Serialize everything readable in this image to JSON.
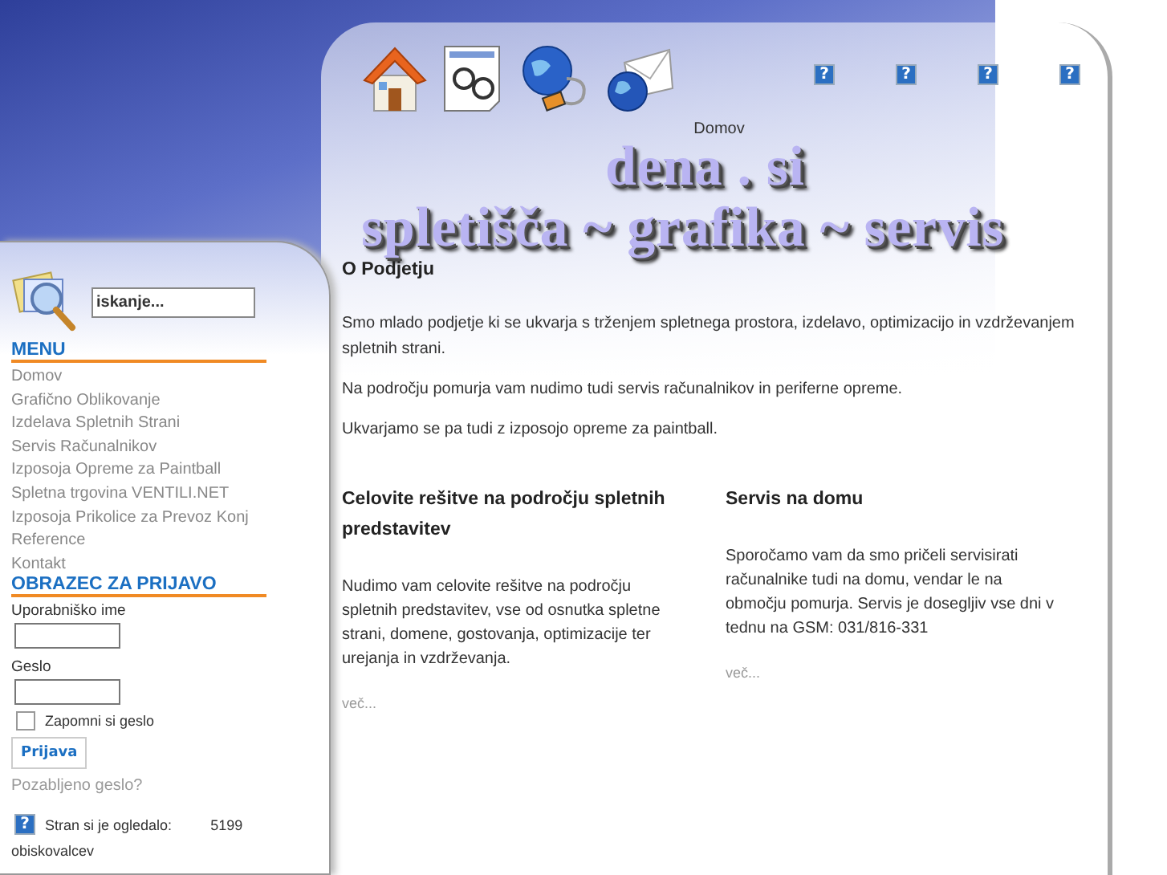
{
  "header": {
    "help_icons": [
      "?",
      "?",
      "?",
      "?"
    ],
    "nav_label": "Domov",
    "logo_line_1": "dena . si",
    "logo_line_2": "spletišča ~ grafika ~ servis"
  },
  "sidebar": {
    "search": {
      "value": "iskanje..."
    },
    "menu": {
      "title": "MENU",
      "items": [
        {
          "label": "Domov"
        },
        {
          "label": "Grafično Oblikovanje"
        },
        {
          "label": "Izdelava Spletnih Strani"
        },
        {
          "label": "Servis Računalnikov"
        },
        {
          "label": "Izposoja Opreme za Paintball"
        },
        {
          "label": "Spletna trgovina VENTILI.NET"
        },
        {
          "label": "Izposoja Prikolice za Prevoz Konj"
        },
        {
          "label": "Reference"
        },
        {
          "label": "Kontakt"
        }
      ]
    },
    "login": {
      "title": "OBRAZEC ZA PRIJAVO",
      "username_label": "Uporabniško ime",
      "password_label": "Geslo",
      "remember": {
        "label": "Zapomni si geslo",
        "checked": false
      },
      "submit": "Prijava",
      "forgot": "Pozabljeno geslo?"
    },
    "counter": {
      "icon": "?",
      "label": "Stran si je ogledalo:",
      "count": "5199",
      "unit": "obiskovalcev"
    }
  },
  "content": {
    "title": "O Podjetju",
    "paragraphs": [
      "Smo mlado podjetje ki se ukvarja s trženjem spletnega prostora, izdelavo, optimizacijo in vzdrževanjem spletnih strani.",
      "Na področju pomurja vam nudimo tudi servis računalnikov in periferne opreme.",
      "Ukvarjamo se pa tudi z izposojo opreme za paintball."
    ],
    "columns": [
      {
        "title": "Celovite rešitve na področju spletnih predstavitev",
        "text": "Nudimo vam celovite rešitve na področju spletnih predstavitev, vse od osnutka spletne strani, domene, gostovanja, optimizacije ter urejanja in vzdrževanja.",
        "more": "več..."
      },
      {
        "title": "Servis na domu",
        "text": "Sporočamo vam da smo pričeli servisirati računalnike tudi na domu, vendar le na območju pomurja.  Servis je dosegljiv vse dni v tednu na GSM: 031/816-331",
        "more": "več..."
      }
    ]
  }
}
